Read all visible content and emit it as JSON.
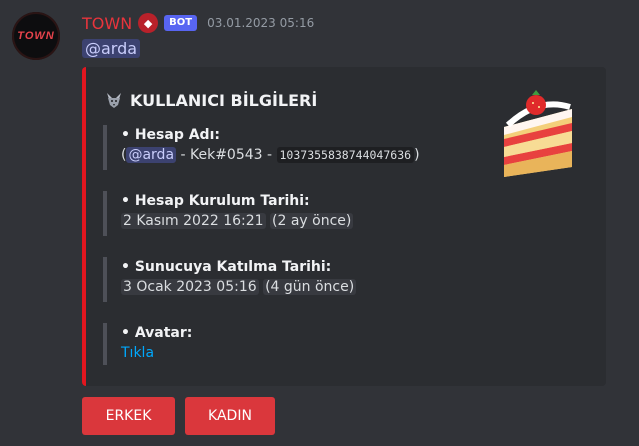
{
  "message": {
    "author": "TOWN",
    "avatar_text": "TOWN",
    "bot_tag": "BOT",
    "timestamp": "03.01.2023 05:16",
    "mention": "@arda"
  },
  "embed": {
    "accent_color": "#e2161f",
    "title": "KULLANICI BİLGİLERİ",
    "thumbnail_icon": "strawberry-cake",
    "fields": {
      "account_name": {
        "label": "• Hesap Adı:",
        "open_paren": "(",
        "mention": "@arda",
        "tag_text": " - Kek#0543 - ",
        "user_id": "1037355838744047636",
        "close_paren": ")"
      },
      "created_at": {
        "label": "• Hesap Kurulum Tarihi:",
        "date": "2 Kasım 2022 16:21",
        "relative": "(2 ay önce)"
      },
      "joined_at": {
        "label": "• Sunucuya Katılma Tarihi:",
        "date": "3 Ocak 2023 05:16",
        "relative": "(4 gün önce)"
      },
      "avatar": {
        "label": "• Avatar:",
        "link": "Tıkla"
      }
    }
  },
  "buttons": {
    "erkek": "ERKEK",
    "kadin": "KADIN"
  }
}
